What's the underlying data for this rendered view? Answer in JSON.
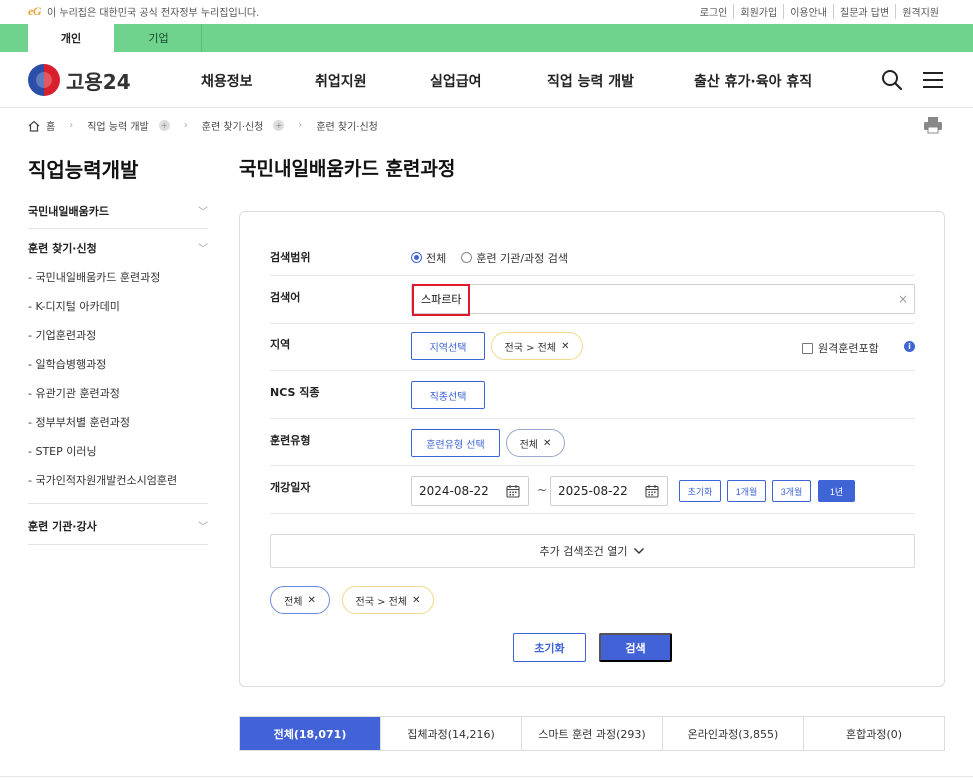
{
  "govbar": {
    "logo": "eG",
    "notice": "이 누리집은 대한민국 공식 전자정부 누리집입니다.",
    "links": [
      "로그인",
      "회원가입",
      "이용안내",
      "질문과 답변",
      "원격지원"
    ]
  },
  "audience_tabs": {
    "personal": "개인",
    "company": "기업"
  },
  "header": {
    "logo_text": "고용24",
    "nav": [
      "채용정보",
      "취업지원",
      "실업급여",
      "직업 능력 개발",
      "출산 휴가·육아 휴직"
    ]
  },
  "breadcrumb": {
    "home": "홈",
    "level1": "직업 능력 개발",
    "level2": "훈련 찾기·신청",
    "level3": "훈련 찾기·신청"
  },
  "sidebar": {
    "title": "직업능력개발",
    "section1": "국민내일배움카드",
    "section2": "훈련 찾기·신청",
    "items": [
      "- 국민내일배움카드 훈련과정",
      "- K-디지털 아카데미",
      "- 기업훈련과정",
      "- 일학습병행과정",
      "- 유관기관 훈련과정",
      "- 정부부처별 훈련과정",
      "- STEP 이러닝",
      "- 국가인적자원개발컨소시엄훈련"
    ],
    "section3": "훈련 기관·강사"
  },
  "page_title": "국민내일배움카드 훈련과정",
  "search": {
    "scope": {
      "label": "검색범위",
      "option_all": "전체",
      "option_inst": "훈련 기관/과정 검색"
    },
    "keyword": {
      "label": "검색어",
      "value": "스파르타"
    },
    "region": {
      "label": "지역",
      "button": "지역선택",
      "chip": "전국 > 전체",
      "remote": "원격훈련포함",
      "info": "i"
    },
    "ncs": {
      "label": "NCS 직종",
      "button": "직종선택"
    },
    "type": {
      "label": "훈련유형",
      "button": "훈련유형 선택",
      "chip": "전체"
    },
    "date": {
      "label": "개강일자",
      "from": "2024-08-22",
      "tilde": "~",
      "to": "2025-08-22",
      "presets": [
        "초기화",
        "1개월",
        "3개월",
        "1년"
      ]
    },
    "more": "추가 검색조건 열기",
    "selected": [
      "전체",
      "전국 > 전체"
    ],
    "reset": "초기화",
    "submit": "검색"
  },
  "result_tabs": [
    "전체(18,071)",
    "집체과정(14,216)",
    "스마트 훈련 과정(293)",
    "온라인과정(3,855)",
    "혼합과정(0)"
  ]
}
